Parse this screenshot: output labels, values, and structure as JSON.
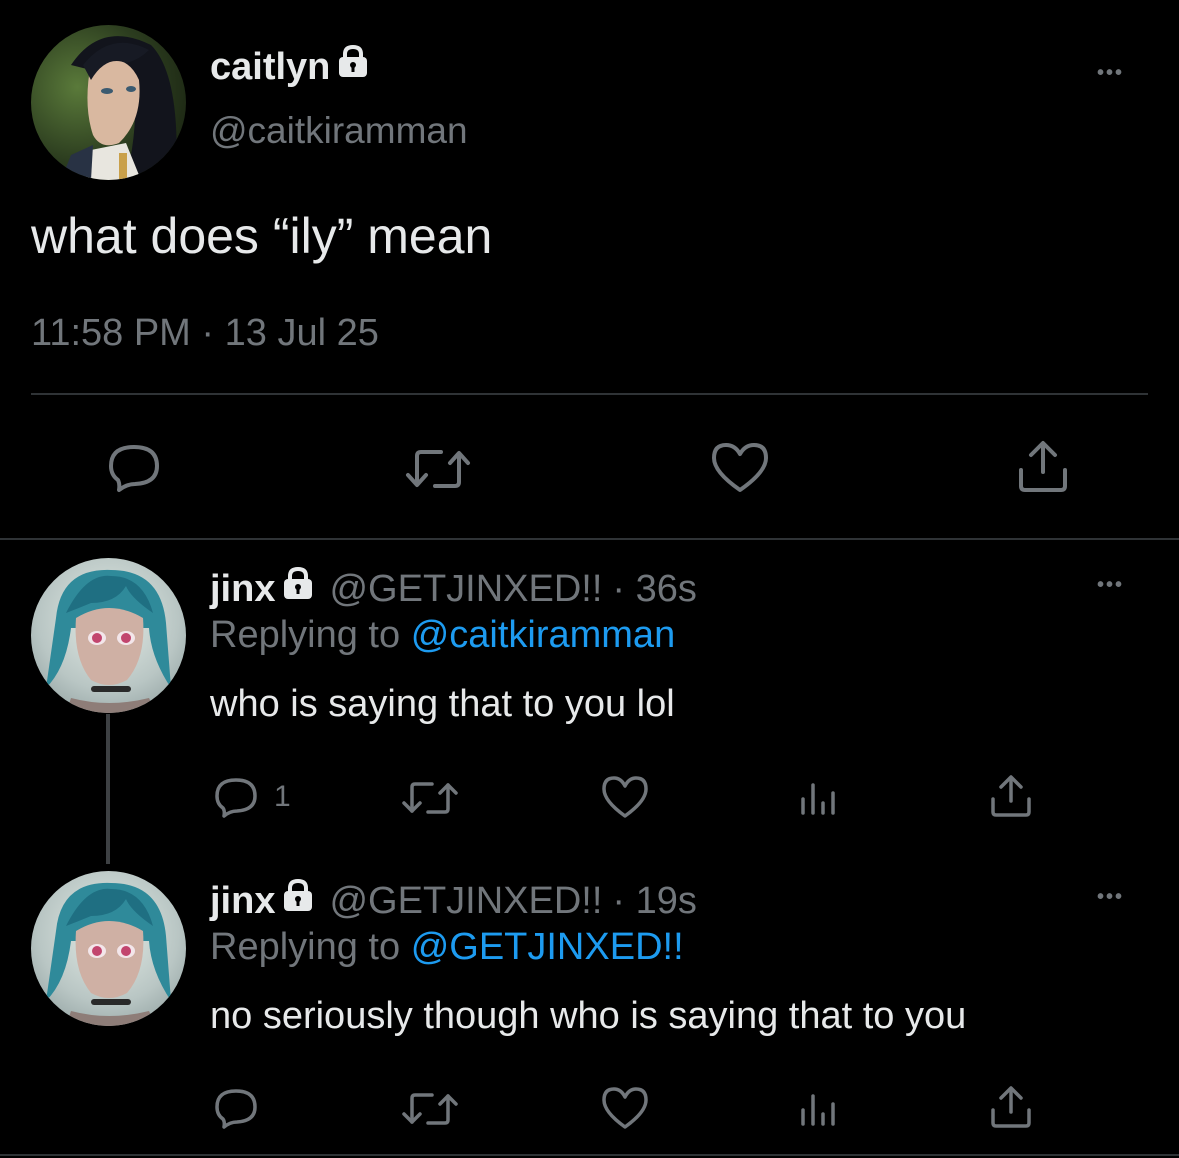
{
  "main_tweet": {
    "author_name": "caitlyn",
    "author_handle": "@caitkiramman",
    "text": "what does “ily” mean",
    "time": "11:58 PM",
    "separator": "·",
    "date": "13 Jul 25",
    "more": "•••"
  },
  "replies": [
    {
      "author_name": "jinx",
      "author_handle": "@GETJINXED!!",
      "age": "· 36s",
      "replying_prefix": "Replying to",
      "replying_to": "@caitkiramman",
      "text": "who is saying that to you lol",
      "reply_count": "1",
      "more": "•••"
    },
    {
      "author_name": "jinx",
      "author_handle": "@GETJINXED!!",
      "age": "· 19s",
      "replying_prefix": "Replying to",
      "replying_to": "@GETJINXED!!",
      "text": "no seriously though who is saying that to you",
      "reply_count": "",
      "more": "•••"
    }
  ],
  "colors": {
    "background": "#000000",
    "text": "#e7e9ea",
    "secondary": "#71767b",
    "link": "#1d9bf0",
    "divider": "#2f3336"
  },
  "icons": [
    "lock-icon",
    "more-icon",
    "reply-icon",
    "retweet-icon",
    "like-icon",
    "share-icon",
    "analytics-icon"
  ]
}
